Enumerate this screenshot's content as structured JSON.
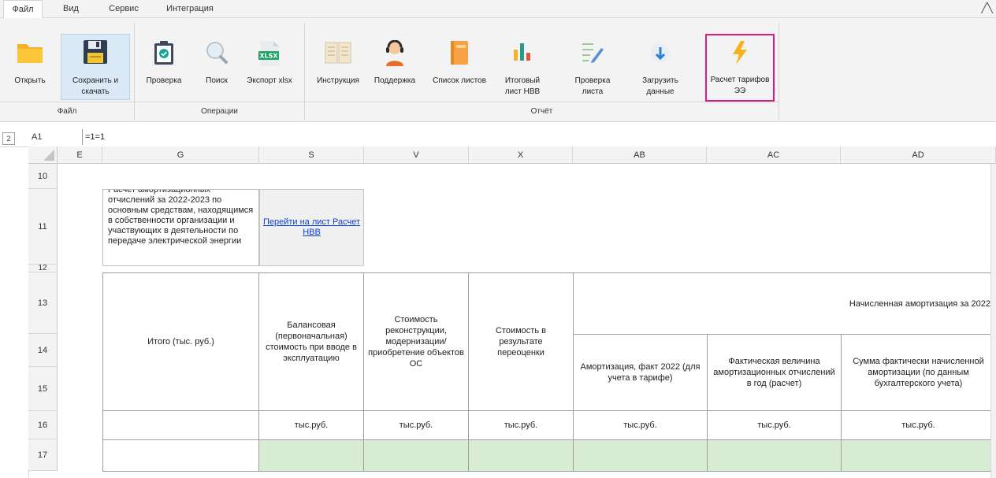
{
  "menu": {
    "tabs": [
      {
        "label": "Файл"
      },
      {
        "label": "Вид"
      },
      {
        "label": "Сервис"
      },
      {
        "label": "Интеграция"
      }
    ]
  },
  "ribbon": {
    "buttons": {
      "open": "Открыть",
      "save": "Сохранить и скачать",
      "check": "Проверка",
      "search": "Поиск",
      "export": "Экспорт xlsx",
      "instruction": "Инструкция",
      "support": "Поддержка",
      "sheet_list": "Список листов",
      "total_sheet": "Итоговый лист НВВ",
      "sheet_check": "Проверка листа",
      "load_data": "Загрузить данные",
      "tariff_calc": "Расчет тарифов ЭЭ"
    },
    "groups": {
      "file": "Файл",
      "operations": "Операции",
      "report": "Отчёт"
    },
    "icon_labels": {
      "export_badge": "XLSX"
    }
  },
  "formula_bar": {
    "cell_ref": "A1",
    "formula": "=1=1"
  },
  "sheet": {
    "outline_level": "2",
    "columns": [
      "E",
      "G",
      "S",
      "V",
      "X",
      "AB",
      "AC",
      "AD"
    ],
    "rows": [
      "10",
      "11",
      "12",
      "13",
      "14",
      "15",
      "16",
      "17"
    ],
    "description": "Расчет амортизационных отчислений за 2022-2023 по основным средствам, находящимся в собственности организации и участвующих в деятельности по передаче электрической энергии",
    "link_text": "Перейти на лист Расчет НВВ",
    "headers": {
      "total": "Итого (тыс. руб.)",
      "balance_cost": "Балансовая (первоначальная) стоимость при вводе в эксплуатацию",
      "modernization_cost": "Стоимость реконструкции, модернизации/приобретение объектов ОС",
      "revaluation_cost": "Стоимость в результате переоценки",
      "accrued_amortization": "Начисленная амортизация за 2022",
      "amortization_fact": "Амортизация, факт 2022 (для учета в тарифе)",
      "actual_deductions": "Фактическая величина амортизационных отчислений в год (расчет)",
      "actual_accrued": "Сумма фактически начисленной амортизации (по данным бухгалтерского учета)"
    },
    "unit": "тыс.руб.",
    "colors": {
      "input_fill": "#d8ecd4",
      "link": "#0b3fd6",
      "highlight": "#e3197d"
    }
  }
}
